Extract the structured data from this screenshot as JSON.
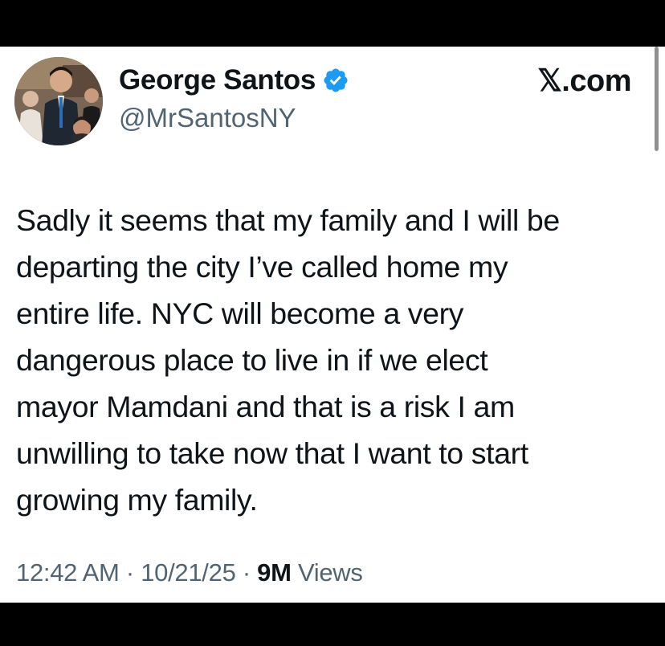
{
  "colors": {
    "text": "#0f1419",
    "secondary": "#536471",
    "verified_badge": "#1d9bf0",
    "background": "#ffffff",
    "letterbox": "#000000"
  },
  "post": {
    "author": {
      "display_name": "George Santos",
      "handle": "@MrSantosNY",
      "verified_icon": "verified-badge-icon",
      "avatar": "profile-photo"
    },
    "brand": "𝕏.com",
    "text_lines": [
      "Sadly it seems that my family and I will be",
      "departing the city I’ve called home my",
      "entire life. NYC will become a very",
      "dangerous place to live in if we elect",
      "mayor Mamdani and that is a risk I am",
      "unwilling to take now that I want to start",
      "growing my family."
    ],
    "time": "12:42 AM",
    "separator": " · ",
    "date": "10/21/25",
    "views_count": "9M",
    "views_label": " Views"
  }
}
